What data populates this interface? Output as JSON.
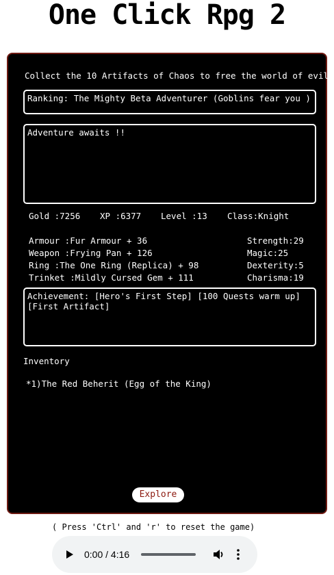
{
  "page": {
    "title": "One Click Rpg 2"
  },
  "game": {
    "intro": "Collect the 10 Artifacts of Chaos to free the world of evil.",
    "ranking": "Ranking: The Mighty Beta Adventurer (Goblins fear you )",
    "log": "Adventure awaits !!",
    "stats": {
      "gold": "Gold :7256",
      "xp": "XP :6377",
      "level": "Level :13",
      "class": "Class:Knight"
    },
    "equipment": {
      "armour": "Armour :Fur Armour + 36",
      "weapon": "Weapon :Frying Pan + 126",
      "ring": "Ring :The One Ring (Replica) + 98",
      "trinket": "Trinket :Mildly Cursed Gem + 111"
    },
    "attributes": {
      "strength": "Strength:29",
      "magic": "Magic:25",
      "dexterity": "Dexterity:5",
      "charisma": "Charisma:19"
    },
    "achievements": "Achievement: [Hero's First Step] [100 Quests warm up] [First Artifact]",
    "inventory_label": "Inventory",
    "inventory_items": [
      "*1)The Red Beherit (Egg of the King)"
    ],
    "explore_label": "Explore",
    "colors": {
      "panel_bg": "#000000",
      "panel_border": "#6e1a12",
      "explore_text": "#8c1a10"
    }
  },
  "reset_hint": "( Press 'Ctrl' and 'r' to reset the game)",
  "audio": {
    "time": "0:00 / 4:16",
    "progress": 0,
    "icons": [
      "play-icon",
      "volume-icon",
      "more-options-icon"
    ]
  }
}
